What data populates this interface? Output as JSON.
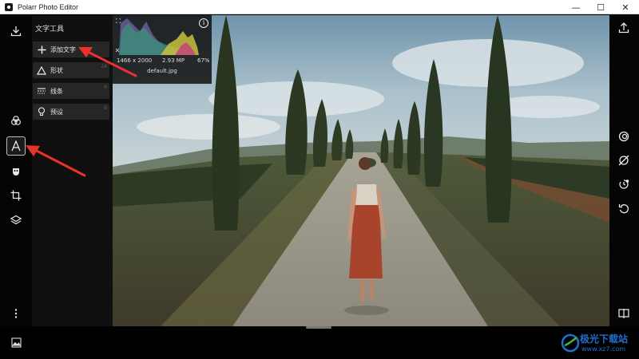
{
  "window": {
    "title": "Polarr Photo Editor",
    "minimize_glyph": "—",
    "maximize_glyph": "☐",
    "close_glyph": "✕"
  },
  "left_rail": {
    "icons": [
      "import-icon",
      "filters-icon",
      "text-tool-icon",
      "face-icon",
      "crop-icon",
      "layers-icon",
      "more-icon"
    ],
    "active": "text-tool-icon"
  },
  "panel": {
    "title": "文字工具",
    "items": [
      {
        "label": "添加文字",
        "icon": "plus-icon",
        "count": ""
      },
      {
        "label": "形状",
        "icon": "triangle-icon",
        "count": "24"
      },
      {
        "label": "线条",
        "icon": "lines-icon",
        "count": "6"
      },
      {
        "label": "预设",
        "icon": "bulb-icon",
        "count": "9"
      }
    ]
  },
  "histogram": {
    "dimensions": "1466 x 2000",
    "megapixels": "2.93 MP",
    "zoom": "67%",
    "filename": "default.jpg",
    "info_glyph": "i"
  },
  "right_rail": {
    "icons": [
      "export-icon",
      "overlay-icon",
      "no-effect-icon",
      "timer-icon",
      "undo-icon",
      "compare-icon"
    ]
  },
  "watermark": {
    "name": "极光下载站",
    "url": "www.xz7.com"
  },
  "colors": {
    "accent_arrow": "#e8322b",
    "watermark_blue": "#1f6fd0"
  }
}
